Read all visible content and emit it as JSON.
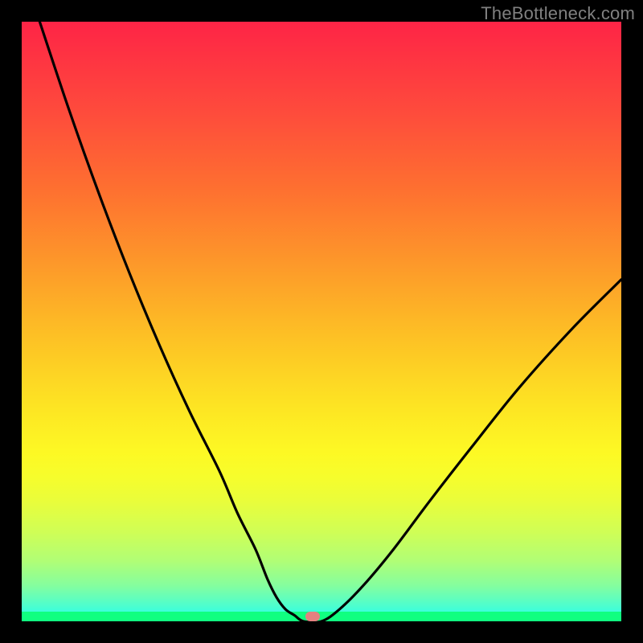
{
  "watermark": "TheBottleneck.com",
  "chart_data": {
    "type": "line",
    "title": "",
    "xlabel": "",
    "ylabel": "",
    "xlim": [
      0,
      100
    ],
    "ylim": [
      0,
      100
    ],
    "x": [
      3,
      8,
      13,
      18,
      23,
      28,
      33,
      36,
      39,
      41,
      42.5,
      44,
      45.5,
      47,
      50,
      53,
      57,
      62,
      68,
      75,
      83,
      92,
      100
    ],
    "values": [
      100,
      85,
      71,
      58,
      46,
      35,
      25,
      18,
      12,
      7,
      4,
      2,
      1,
      0,
      0,
      2,
      6,
      12,
      20,
      29,
      39,
      49,
      57
    ],
    "marker": {
      "x": 48.5,
      "y": 0
    },
    "gradient_stops": [
      {
        "pos": 0,
        "color": "#fe2446"
      },
      {
        "pos": 50,
        "color": "#fdbf25"
      },
      {
        "pos": 75,
        "color": "#fdf924"
      },
      {
        "pos": 100,
        "color": "#21fef2"
      }
    ]
  }
}
